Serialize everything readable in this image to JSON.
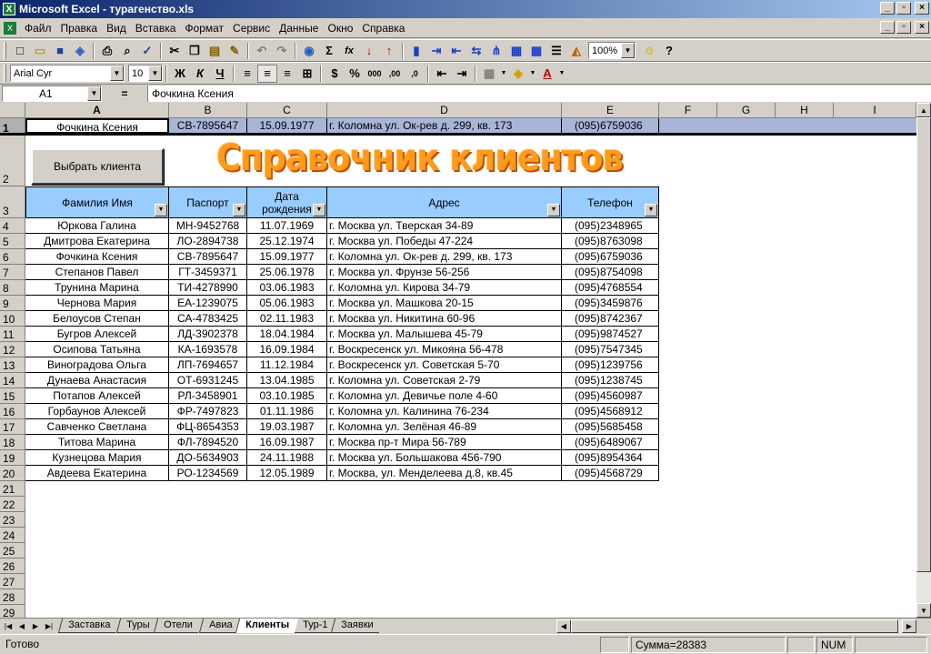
{
  "window": {
    "title": "Microsoft Excel - турагенство.xls",
    "app_icon_glyph": "X",
    "minimize_glyph": "_",
    "restore_glyph": "▫",
    "close_glyph": "×"
  },
  "menu": {
    "items": [
      "Файл",
      "Правка",
      "Вид",
      "Вставка",
      "Формат",
      "Сервис",
      "Данные",
      "Окно",
      "Справка"
    ]
  },
  "toolbar": {
    "zoom": "100%",
    "font_name": "Arial Cyr",
    "font_size": "10",
    "bold": "Ж",
    "italic": "К",
    "underline": "Ч",
    "currency": "$",
    "percent": "%",
    "thousands": "000",
    "inc_decimal": ",00",
    "dec_decimal": ",0",
    "sum": "Σ",
    "fx": "fx",
    "font_color_glyph": "A"
  },
  "formula_bar": {
    "cell_ref": "A1",
    "eq": "=",
    "value": "Фочкина Ксения"
  },
  "columns": [
    "A",
    "B",
    "C",
    "D",
    "E",
    "F",
    "G",
    "H",
    "I"
  ],
  "row_numbers": [
    "1",
    "2",
    "3",
    "4",
    "5",
    "6",
    "7",
    "8",
    "9",
    "10",
    "11",
    "12",
    "13",
    "14",
    "15",
    "16",
    "17",
    "18",
    "19",
    "20",
    "21",
    "22",
    "23",
    "24",
    "25",
    "26",
    "27",
    "28",
    "29"
  ],
  "row1": {
    "name": "Фочкина Ксения",
    "passport": "СВ-7895647",
    "dob": "15.09.1977",
    "address": "г. Коломна ул. Ок-рев д. 299, кв. 173",
    "phone": "(095)6759036"
  },
  "select_button": "Выбрать клиента",
  "wordart_title": "Справочник клиентов",
  "headers": {
    "name": "Фамилия Имя",
    "passport": "Паспорт",
    "dob": "Дата рождения",
    "address": "Адрес",
    "phone": "Телефон"
  },
  "clients": [
    [
      "Юркова Галина",
      "МН-9452768",
      "11.07.1969",
      "г. Москва ул. Тверская 34-89",
      "(095)2348965"
    ],
    [
      "Дмитрова Екатерина",
      "ЛО-2894738",
      "25.12.1974",
      "г. Москва ул. Победы 47-224",
      "(095)8763098"
    ],
    [
      "Фочкина Ксения",
      "СВ-7895647",
      "15.09.1977",
      "г. Коломна ул. Ок-рев д. 299, кв. 173",
      "(095)6759036"
    ],
    [
      "Степанов Павел",
      "ГТ-3459371",
      "25.06.1978",
      "г. Москва ул. Фрунзе 56-256",
      "(095)8754098"
    ],
    [
      "Трунина Марина",
      "ТИ-4278990",
      "03.06.1983",
      "г. Коломна ул. Кирова 34-79",
      "(095)4768554"
    ],
    [
      "Чернова Мария",
      "ЕА-1239075",
      "05.06.1983",
      "г. Москва ул. Машкова 20-15",
      "(095)3459876"
    ],
    [
      "Белоусов Степан",
      "СА-4783425",
      "02.11.1983",
      "г. Москва ул. Никитина 60-96",
      "(095)8742367"
    ],
    [
      "Бугров Алексей",
      "ЛД-3902378",
      "18.04.1984",
      "г. Москва ул. Малышева 45-79",
      "(095)9874527"
    ],
    [
      "Осипова Татьяна",
      "КА-1693578",
      "16.09.1984",
      "г. Воскресенск ул. Микояна 56-478",
      "(095)7547345"
    ],
    [
      "Виноградова Ольга",
      "ЛП-7694657",
      "11.12.1984",
      "г. Воскресенск ул. Советская 5-70",
      "(095)1239756"
    ],
    [
      "Дунаева Анастасия",
      "ОТ-6931245",
      "13.04.1985",
      "г. Коломна ул. Советская 2-79",
      "(095)1238745"
    ],
    [
      "Потапов Алексей",
      "РЛ-3458901",
      "03.10.1985",
      "г. Коломна ул. Девичье поле 4-60",
      "(095)4560987"
    ],
    [
      "Горбаунов Алексей",
      "ФР-7497823",
      "01.11.1986",
      "г. Коломна ул. Калинина 76-234",
      "(095)4568912"
    ],
    [
      "Савченко Светлана",
      "ФЦ-8654353",
      "19.03.1987",
      "г. Коломна ул. Зелёная 46-89",
      "(095)5685458"
    ],
    [
      "Титова Марина",
      "ФЛ-7894520",
      "16.09.1987",
      "г. Москва пр-т Мира 56-789",
      "(095)6489067"
    ],
    [
      "Кузнецова Мария",
      "ДО-5634903",
      "24.11.1988",
      "г. Москва ул. Большакова 456-790",
      "(095)8954364"
    ],
    [
      "Авдеева Екатерина",
      "РО-1234569",
      "12.05.1989",
      "г. Москва, ул. Менделеева д.8, кв.45",
      "(095)4568729"
    ]
  ],
  "sheet_tabs": [
    "Заставка",
    "Туры",
    "Отели",
    "Авиа",
    "Клиенты",
    "Тур-1",
    "Заявки"
  ],
  "active_tab": "Клиенты",
  "status": {
    "ready": "Готово",
    "sum": "Сумма=28383",
    "num": "NUM"
  },
  "colors": {
    "header_fill": "#99ccff",
    "row1_fill": "#a9b5d8",
    "wordart": "#ff9a1a"
  }
}
